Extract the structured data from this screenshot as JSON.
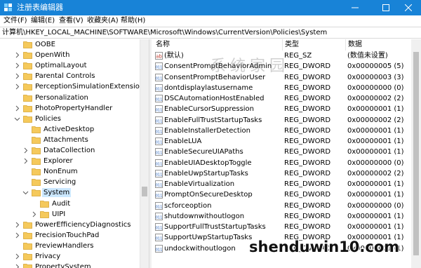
{
  "window": {
    "title": "注册表编辑器",
    "titlebar_color": "#1883d7",
    "controls": [
      "minimize-icon",
      "maximize-icon",
      "close-icon"
    ]
  },
  "menu": [
    "文件(F)",
    "编辑(E)",
    "查看(V)",
    "收藏夹(A)",
    "帮助(H)"
  ],
  "address": "计算机\\HKEY_LOCAL_MACHINE\\SOFTWARE\\Microsoft\\Windows\\CurrentVersion\\Policies\\System",
  "tree": {
    "items": [
      {
        "label": "OOBE",
        "level": 0,
        "expand": "none",
        "selected": false
      },
      {
        "label": "OpenWith",
        "level": 0,
        "expand": "collapsed",
        "selected": false
      },
      {
        "label": "OptimalLayout",
        "level": 0,
        "expand": "collapsed",
        "selected": false
      },
      {
        "label": "Parental Controls",
        "level": 0,
        "expand": "collapsed",
        "selected": false
      },
      {
        "label": "PerceptionSimulationExtensions",
        "level": 0,
        "expand": "collapsed",
        "selected": false
      },
      {
        "label": "Personalization",
        "level": 0,
        "expand": "none",
        "selected": false
      },
      {
        "label": "PhotoPropertyHandler",
        "level": 0,
        "expand": "collapsed",
        "selected": false
      },
      {
        "label": "Policies",
        "level": 0,
        "expand": "expanded",
        "selected": false
      },
      {
        "label": "ActiveDesktop",
        "level": 1,
        "expand": "none",
        "selected": false
      },
      {
        "label": "Attachments",
        "level": 1,
        "expand": "none",
        "selected": false
      },
      {
        "label": "DataCollection",
        "level": 1,
        "expand": "collapsed",
        "selected": false
      },
      {
        "label": "Explorer",
        "level": 1,
        "expand": "collapsed",
        "selected": false
      },
      {
        "label": "NonEnum",
        "level": 1,
        "expand": "none",
        "selected": false
      },
      {
        "label": "Servicing",
        "level": 1,
        "expand": "none",
        "selected": false
      },
      {
        "label": "System",
        "level": 1,
        "expand": "expanded",
        "selected": true
      },
      {
        "label": "Audit",
        "level": 2,
        "expand": "none",
        "selected": false
      },
      {
        "label": "UIPI",
        "level": 2,
        "expand": "collapsed",
        "selected": false
      },
      {
        "label": "PowerEfficiencyDiagnostics",
        "level": 0,
        "expand": "collapsed",
        "selected": false
      },
      {
        "label": "PrecisionTouchPad",
        "level": 0,
        "expand": "collapsed",
        "selected": false
      },
      {
        "label": "PreviewHandlers",
        "level": 0,
        "expand": "none",
        "selected": false
      },
      {
        "label": "Privacy",
        "level": 0,
        "expand": "collapsed",
        "selected": false
      },
      {
        "label": "PropertySystem",
        "level": 0,
        "expand": "collapsed",
        "selected": false
      }
    ]
  },
  "columns": {
    "name": "名称",
    "type": "类型",
    "data": "数据"
  },
  "values": [
    {
      "icon": "string-value-icon",
      "name": "(默认)",
      "type": "REG_SZ",
      "data": "(数值未设置)"
    },
    {
      "icon": "binary-value-icon",
      "name": "ConsentPromptBehaviorAdmin",
      "type": "REG_DWORD",
      "data": "0x00000005 (5)"
    },
    {
      "icon": "binary-value-icon",
      "name": "ConsentPromptBehaviorUser",
      "type": "REG_DWORD",
      "data": "0x00000003 (3)"
    },
    {
      "icon": "binary-value-icon",
      "name": "dontdisplaylastusername",
      "type": "REG_DWORD",
      "data": "0x00000000 (0)"
    },
    {
      "icon": "binary-value-icon",
      "name": "DSCAutomationHostEnabled",
      "type": "REG_DWORD",
      "data": "0x00000002 (2)"
    },
    {
      "icon": "binary-value-icon",
      "name": "EnableCursorSuppression",
      "type": "REG_DWORD",
      "data": "0x00000001 (1)"
    },
    {
      "icon": "binary-value-icon",
      "name": "EnableFullTrustStartupTasks",
      "type": "REG_DWORD",
      "data": "0x00000002 (2)"
    },
    {
      "icon": "binary-value-icon",
      "name": "EnableInstallerDetection",
      "type": "REG_DWORD",
      "data": "0x00000001 (1)"
    },
    {
      "icon": "binary-value-icon",
      "name": "EnableLUA",
      "type": "REG_DWORD",
      "data": "0x00000001 (1)"
    },
    {
      "icon": "binary-value-icon",
      "name": "EnableSecureUIAPaths",
      "type": "REG_DWORD",
      "data": "0x00000001 (1)"
    },
    {
      "icon": "binary-value-icon",
      "name": "EnableUIADesktopToggle",
      "type": "REG_DWORD",
      "data": "0x00000000 (0)"
    },
    {
      "icon": "binary-value-icon",
      "name": "EnableUwpStartupTasks",
      "type": "REG_DWORD",
      "data": "0x00000002 (2)"
    },
    {
      "icon": "binary-value-icon",
      "name": "EnableVirtualization",
      "type": "REG_DWORD",
      "data": "0x00000001 (1)"
    },
    {
      "icon": "binary-value-icon",
      "name": "PromptOnSecureDesktop",
      "type": "REG_DWORD",
      "data": "0x00000001 (1)"
    },
    {
      "icon": "binary-value-icon",
      "name": "scforceoption",
      "type": "REG_DWORD",
      "data": "0x00000000 (0)"
    },
    {
      "icon": "binary-value-icon",
      "name": "shutdownwithoutlogon",
      "type": "REG_DWORD",
      "data": "0x00000001 (1)"
    },
    {
      "icon": "binary-value-icon",
      "name": "SupportFullTrustStartupTasks",
      "type": "REG_DWORD",
      "data": "0x00000001 (1)"
    },
    {
      "icon": "binary-value-icon",
      "name": "SupportUwpStartupTasks",
      "type": "REG_DWORD",
      "data": "0x00000001 (1)"
    },
    {
      "icon": "binary-value-icon",
      "name": "undockwithoutlogon",
      "type": "REG_DWORD",
      "data": "0x00000001 (1)"
    }
  ],
  "watermark": "系统家园",
  "site_mark": "shenduwin10.com",
  "colors": {
    "selection": "#cce8ff",
    "folder": "#f5c95b",
    "accent": "#1883d7"
  }
}
